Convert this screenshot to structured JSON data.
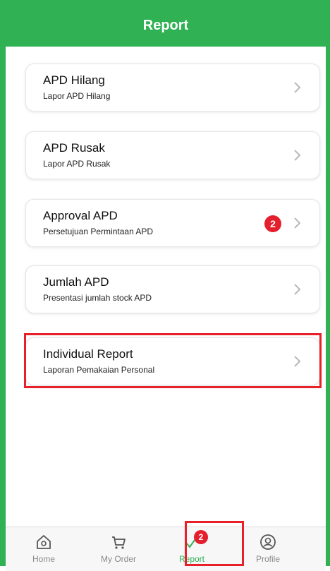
{
  "header": {
    "title": "Report"
  },
  "menu": [
    {
      "title": "APD Hilang",
      "subtitle": "Lapor APD Hilang"
    },
    {
      "title": "APD Rusak",
      "subtitle": "Lapor APD Rusak"
    },
    {
      "title": "Approval APD",
      "subtitle": "Persetujuan Permintaan APD",
      "badge": "2"
    },
    {
      "title": "Jumlah APD",
      "subtitle": "Presentasi jumlah stock APD"
    },
    {
      "title": "Individual Report",
      "subtitle": "Laporan Pemakaian Personal"
    }
  ],
  "tabs": [
    {
      "label": "Home",
      "icon": "home-icon"
    },
    {
      "label": "My Order",
      "icon": "cart-icon"
    },
    {
      "label": "Report",
      "icon": "check-icon",
      "badge": "2",
      "active": true
    },
    {
      "label": "Profile",
      "icon": "profile-icon"
    }
  ],
  "colors": {
    "brand": "#2fb154",
    "badge": "#e4202e",
    "highlight": "#e8202a"
  }
}
